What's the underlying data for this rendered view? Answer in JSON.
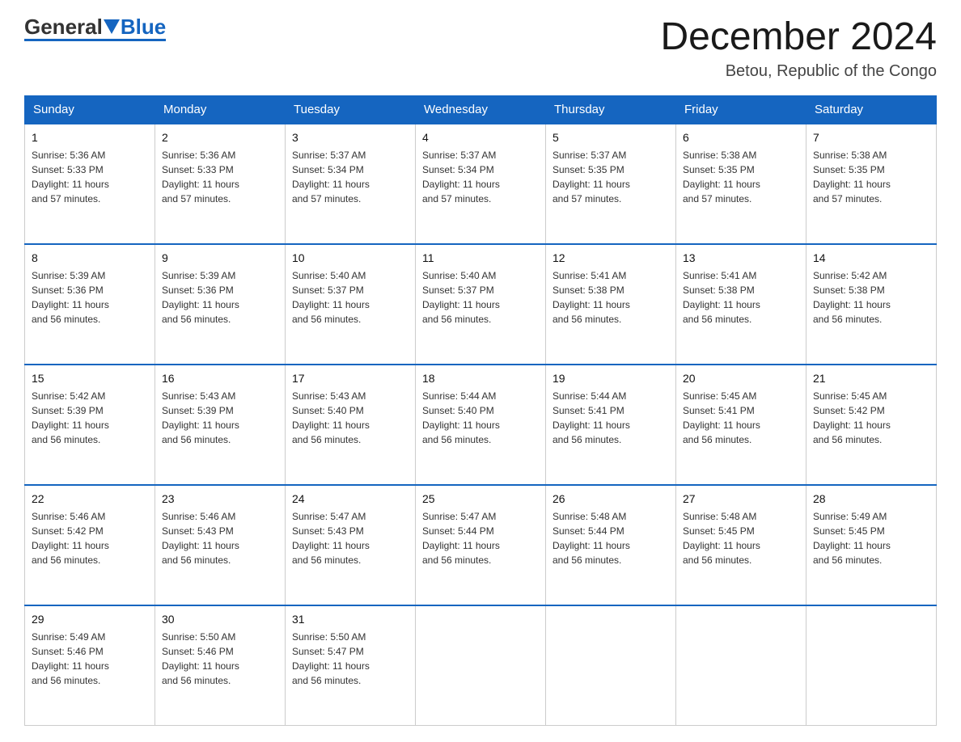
{
  "logo": {
    "general": "General",
    "blue": "Blue"
  },
  "header": {
    "month_title": "December 2024",
    "location": "Betou, Republic of the Congo"
  },
  "days_of_week": [
    "Sunday",
    "Monday",
    "Tuesday",
    "Wednesday",
    "Thursday",
    "Friday",
    "Saturday"
  ],
  "weeks": [
    [
      {
        "day": "1",
        "sunrise": "5:36 AM",
        "sunset": "5:33 PM",
        "daylight": "11 hours and 57 minutes."
      },
      {
        "day": "2",
        "sunrise": "5:36 AM",
        "sunset": "5:33 PM",
        "daylight": "11 hours and 57 minutes."
      },
      {
        "day": "3",
        "sunrise": "5:37 AM",
        "sunset": "5:34 PM",
        "daylight": "11 hours and 57 minutes."
      },
      {
        "day": "4",
        "sunrise": "5:37 AM",
        "sunset": "5:34 PM",
        "daylight": "11 hours and 57 minutes."
      },
      {
        "day": "5",
        "sunrise": "5:37 AM",
        "sunset": "5:35 PM",
        "daylight": "11 hours and 57 minutes."
      },
      {
        "day": "6",
        "sunrise": "5:38 AM",
        "sunset": "5:35 PM",
        "daylight": "11 hours and 57 minutes."
      },
      {
        "day": "7",
        "sunrise": "5:38 AM",
        "sunset": "5:35 PM",
        "daylight": "11 hours and 57 minutes."
      }
    ],
    [
      {
        "day": "8",
        "sunrise": "5:39 AM",
        "sunset": "5:36 PM",
        "daylight": "11 hours and 56 minutes."
      },
      {
        "day": "9",
        "sunrise": "5:39 AM",
        "sunset": "5:36 PM",
        "daylight": "11 hours and 56 minutes."
      },
      {
        "day": "10",
        "sunrise": "5:40 AM",
        "sunset": "5:37 PM",
        "daylight": "11 hours and 56 minutes."
      },
      {
        "day": "11",
        "sunrise": "5:40 AM",
        "sunset": "5:37 PM",
        "daylight": "11 hours and 56 minutes."
      },
      {
        "day": "12",
        "sunrise": "5:41 AM",
        "sunset": "5:38 PM",
        "daylight": "11 hours and 56 minutes."
      },
      {
        "day": "13",
        "sunrise": "5:41 AM",
        "sunset": "5:38 PM",
        "daylight": "11 hours and 56 minutes."
      },
      {
        "day": "14",
        "sunrise": "5:42 AM",
        "sunset": "5:38 PM",
        "daylight": "11 hours and 56 minutes."
      }
    ],
    [
      {
        "day": "15",
        "sunrise": "5:42 AM",
        "sunset": "5:39 PM",
        "daylight": "11 hours and 56 minutes."
      },
      {
        "day": "16",
        "sunrise": "5:43 AM",
        "sunset": "5:39 PM",
        "daylight": "11 hours and 56 minutes."
      },
      {
        "day": "17",
        "sunrise": "5:43 AM",
        "sunset": "5:40 PM",
        "daylight": "11 hours and 56 minutes."
      },
      {
        "day": "18",
        "sunrise": "5:44 AM",
        "sunset": "5:40 PM",
        "daylight": "11 hours and 56 minutes."
      },
      {
        "day": "19",
        "sunrise": "5:44 AM",
        "sunset": "5:41 PM",
        "daylight": "11 hours and 56 minutes."
      },
      {
        "day": "20",
        "sunrise": "5:45 AM",
        "sunset": "5:41 PM",
        "daylight": "11 hours and 56 minutes."
      },
      {
        "day": "21",
        "sunrise": "5:45 AM",
        "sunset": "5:42 PM",
        "daylight": "11 hours and 56 minutes."
      }
    ],
    [
      {
        "day": "22",
        "sunrise": "5:46 AM",
        "sunset": "5:42 PM",
        "daylight": "11 hours and 56 minutes."
      },
      {
        "day": "23",
        "sunrise": "5:46 AM",
        "sunset": "5:43 PM",
        "daylight": "11 hours and 56 minutes."
      },
      {
        "day": "24",
        "sunrise": "5:47 AM",
        "sunset": "5:43 PM",
        "daylight": "11 hours and 56 minutes."
      },
      {
        "day": "25",
        "sunrise": "5:47 AM",
        "sunset": "5:44 PM",
        "daylight": "11 hours and 56 minutes."
      },
      {
        "day": "26",
        "sunrise": "5:48 AM",
        "sunset": "5:44 PM",
        "daylight": "11 hours and 56 minutes."
      },
      {
        "day": "27",
        "sunrise": "5:48 AM",
        "sunset": "5:45 PM",
        "daylight": "11 hours and 56 minutes."
      },
      {
        "day": "28",
        "sunrise": "5:49 AM",
        "sunset": "5:45 PM",
        "daylight": "11 hours and 56 minutes."
      }
    ],
    [
      {
        "day": "29",
        "sunrise": "5:49 AM",
        "sunset": "5:46 PM",
        "daylight": "11 hours and 56 minutes."
      },
      {
        "day": "30",
        "sunrise": "5:50 AM",
        "sunset": "5:46 PM",
        "daylight": "11 hours and 56 minutes."
      },
      {
        "day": "31",
        "sunrise": "5:50 AM",
        "sunset": "5:47 PM",
        "daylight": "11 hours and 56 minutes."
      },
      null,
      null,
      null,
      null
    ]
  ],
  "labels": {
    "sunrise": "Sunrise:",
    "sunset": "Sunset:",
    "daylight": "Daylight:"
  }
}
